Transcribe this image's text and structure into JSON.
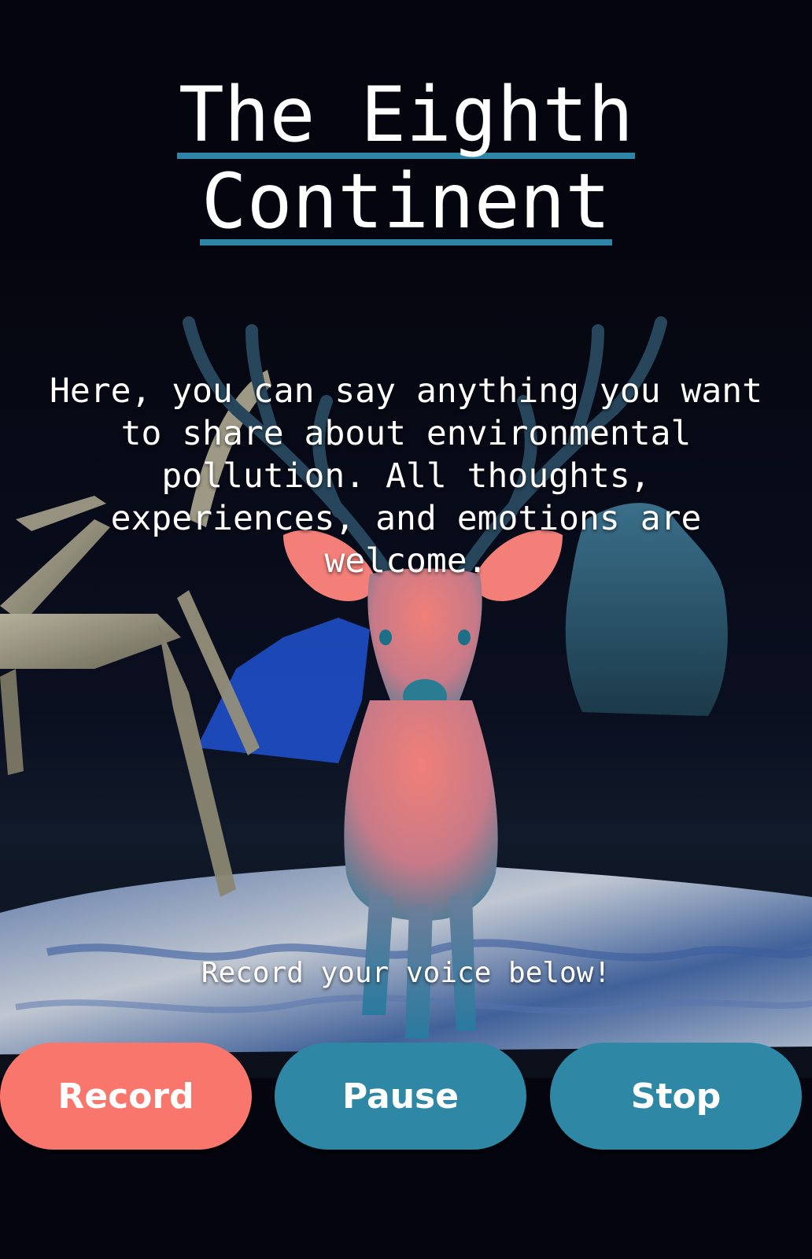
{
  "title": {
    "line1": "The Eighth",
    "line2": "Continent"
  },
  "prompt_text": "Here, you can say anything you want to share about environmental pollution. All thoughts, experiences, and emotions are welcome.",
  "hint_text": "Record your voice below!",
  "buttons": {
    "record": "Record",
    "pause": "Pause",
    "stop": "Stop"
  },
  "colors": {
    "background": "#04050f",
    "accent_underline": "#2d86a6",
    "record_button": "#f8766b",
    "control_button": "#2e87a4"
  }
}
